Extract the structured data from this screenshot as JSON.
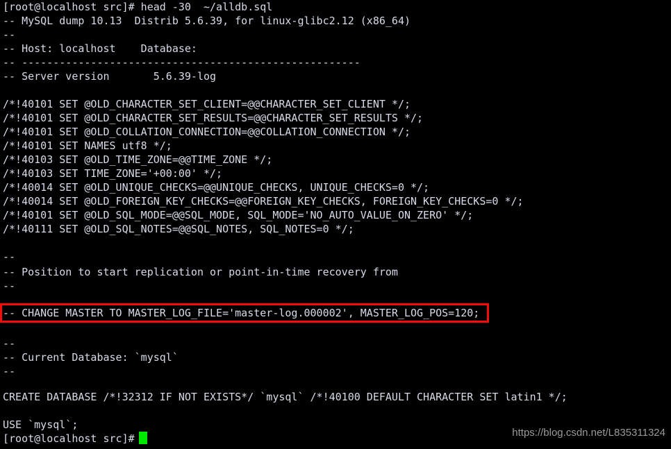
{
  "terminal": {
    "background_color": "#000000",
    "foreground_color": "#d6dbe8",
    "cursor_color": "#00e802",
    "highlight_color": "#fb0b07",
    "prompt": "[root@localhost src]#",
    "command": "head -30  ~/alldb.sql",
    "lines": [
      "[root@localhost src]# head -30  ~/alldb.sql",
      "-- MySQL dump 10.13  Distrib 5.6.39, for linux-glibc2.12 (x86_64)",
      "--",
      "-- Host: localhost    Database: ",
      "-- ------------------------------------------------------",
      "-- Server version       5.6.39-log",
      "",
      "/*!40101 SET @OLD_CHARACTER_SET_CLIENT=@@CHARACTER_SET_CLIENT */;",
      "/*!40101 SET @OLD_CHARACTER_SET_RESULTS=@@CHARACTER_SET_RESULTS */;",
      "/*!40101 SET @OLD_COLLATION_CONNECTION=@@COLLATION_CONNECTION */;",
      "/*!40101 SET NAMES utf8 */;",
      "/*!40103 SET @OLD_TIME_ZONE=@@TIME_ZONE */;",
      "/*!40103 SET TIME_ZONE='+00:00' */;",
      "/*!40014 SET @OLD_UNIQUE_CHECKS=@@UNIQUE_CHECKS, UNIQUE_CHECKS=0 */;",
      "/*!40014 SET @OLD_FOREIGN_KEY_CHECKS=@@FOREIGN_KEY_CHECKS, FOREIGN_KEY_CHECKS=0 */;",
      "/*!40101 SET @OLD_SQL_MODE=@@SQL_MODE, SQL_MODE='NO_AUTO_VALUE_ON_ZERO' */;",
      "/*!40111 SET @OLD_SQL_NOTES=@@SQL_NOTES, SQL_NOTES=0 */;",
      "",
      "--",
      "-- Position to start replication or point-in-time recovery from",
      "--",
      "",
      "-- CHANGE MASTER TO MASTER_LOG_FILE='master-log.000002', MASTER_LOG_POS=120;",
      "",
      "--",
      "-- Current Database: `mysql`",
      "--",
      "",
      "CREATE DATABASE /*!32312 IF NOT EXISTS*/ `mysql` /*!40100 DEFAULT CHARACTER SET latin1 */;",
      "",
      "USE `mysql`;",
      "[root@localhost src]# "
    ],
    "highlighted_line": "-- CHANGE MASTER TO MASTER_LOG_FILE='master-log.000002', MASTER_LOG_POS=120;",
    "highlighted_values": {
      "master_log_file": "master-log.000002",
      "master_log_pos": "120"
    }
  },
  "watermark": {
    "text": "https://blog.csdn.net/L835311324"
  }
}
